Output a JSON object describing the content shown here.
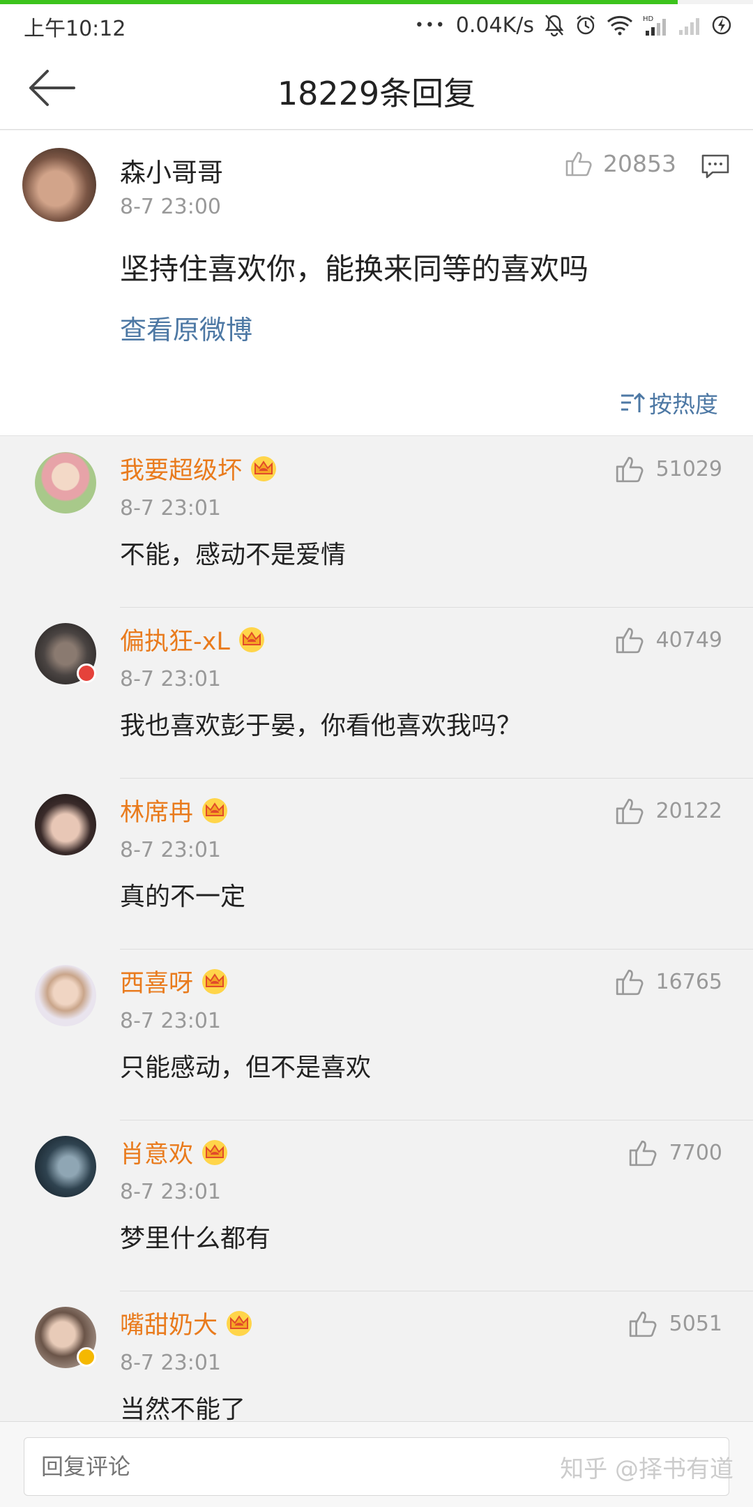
{
  "status_bar": {
    "time": "上午10:12",
    "dots": "•••",
    "speed": "0.04K/s",
    "icons": [
      "bell-off-icon",
      "alarm-icon",
      "wifi-icon",
      "signal-hd-icon",
      "signal-icon",
      "battery-charging-icon"
    ]
  },
  "page_load_progress": 0.9,
  "header": {
    "title": "18229条回复"
  },
  "root_comment": {
    "name": "森小哥哥",
    "time": "8-7 23:00",
    "text": "坚持住喜欢你，能换来同等的喜欢吗",
    "likes": "20853",
    "link": "查看原微博",
    "sort_label": "按热度"
  },
  "replies": [
    {
      "name": "我要超级坏",
      "time": "8-7 23:01",
      "text": "不能，感动不是爱情",
      "likes": "51029"
    },
    {
      "name": "偏执狂-xL",
      "time": "8-7 23:01",
      "text": "我也喜欢彭于晏，你看他喜欢我吗？",
      "likes": "40749"
    },
    {
      "name": "林席冉",
      "time": "8-7 23:01",
      "text": "真的不一定",
      "likes": "20122"
    },
    {
      "name": "西喜呀",
      "time": "8-7 23:01",
      "text": "只能感动，但不是喜欢",
      "likes": "16765"
    },
    {
      "name": "肖意欢",
      "time": "8-7 23:01",
      "text": "梦里什么都有",
      "likes": "7700"
    },
    {
      "name": "嘴甜奶大",
      "time": "8-7 23:01",
      "text": "当然不能了",
      "likes": "5051"
    }
  ],
  "bottom": {
    "placeholder": "回复评论",
    "watermark": "知乎 @择书有道"
  },
  "colors": {
    "accent_link": "#4d78a4",
    "username": "#e97b1d",
    "progress": "#3cc31c"
  }
}
